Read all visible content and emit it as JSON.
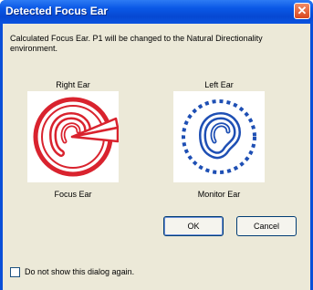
{
  "window": {
    "title": "Detected Focus Ear",
    "close_icon": "close-icon"
  },
  "dialog": {
    "message": "Calculated Focus Ear.  P1 will be changed to the Natural Directionality environment.",
    "right_ear": {
      "heading": "Right Ear",
      "caption": "Focus Ear",
      "icon": "focus-ear-icon",
      "color": "#d9232e"
    },
    "left_ear": {
      "heading": "Left Ear",
      "caption": "Monitor Ear",
      "icon": "monitor-ear-icon",
      "color": "#1e4fb4"
    }
  },
  "buttons": {
    "ok": "OK",
    "cancel": "Cancel"
  },
  "checkbox": {
    "label": "Do not show this dialog again.",
    "checked": false
  }
}
